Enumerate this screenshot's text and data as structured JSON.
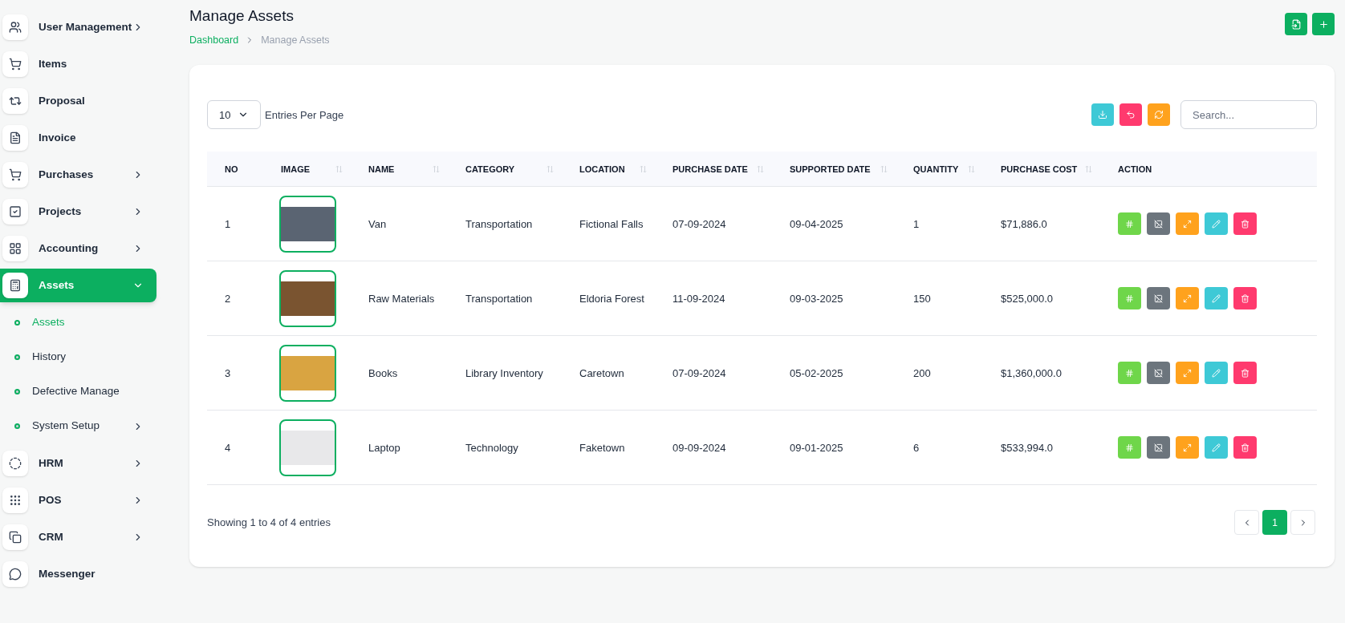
{
  "sidebar": {
    "items": [
      {
        "label": "User Management",
        "kind": "group",
        "selected": false
      },
      {
        "label": "Items",
        "kind": "link",
        "selected": false
      },
      {
        "label": "Proposal",
        "kind": "link",
        "selected": false
      },
      {
        "label": "Invoice",
        "kind": "link",
        "selected": false
      },
      {
        "label": "Purchases",
        "kind": "group",
        "selected": false
      },
      {
        "label": "Projects",
        "kind": "group",
        "selected": false
      },
      {
        "label": "Accounting",
        "kind": "group",
        "selected": false
      },
      {
        "label": "Assets",
        "kind": "group",
        "selected": true,
        "expanded": true,
        "children": [
          {
            "label": "Assets",
            "kind": "link",
            "selected": true
          },
          {
            "label": "History",
            "kind": "link",
            "selected": false
          },
          {
            "label": "Defective Manage",
            "kind": "link",
            "selected": false
          },
          {
            "label": "System Setup",
            "kind": "group",
            "selected": false
          }
        ]
      },
      {
        "label": "HRM",
        "kind": "group",
        "selected": false
      },
      {
        "label": "POS",
        "kind": "group",
        "selected": false
      },
      {
        "label": "CRM",
        "kind": "group",
        "selected": false
      },
      {
        "label": "Messenger",
        "kind": "link",
        "selected": false
      }
    ]
  },
  "page": {
    "title": "Manage Assets",
    "breadcrumb": [
      "Dashboard",
      "Manage Assets"
    ]
  },
  "toolbar": {
    "per_page": "10",
    "per_page_label": "Entries Per Page",
    "search": {
      "placeholder": "Search..."
    }
  },
  "table": {
    "columns": [
      {
        "label": "NO",
        "sortable": false
      },
      {
        "label": "IMAGE",
        "sortable": true
      },
      {
        "label": "NAME",
        "sortable": true
      },
      {
        "label": "CATEGORY",
        "sortable": true
      },
      {
        "label": "LOCATION",
        "sortable": true
      },
      {
        "label": "PURCHASE DATE",
        "sortable": true
      },
      {
        "label": "SUPPORTED DATE",
        "sortable": true
      },
      {
        "label": "QUANTITY",
        "sortable": true
      },
      {
        "label": "PURCHASE COST",
        "sortable": true
      },
      {
        "label": "ACTION",
        "sortable": false
      }
    ],
    "rows": [
      {
        "no": "1",
        "name": "Van",
        "category": "Transportation",
        "location": "Fictional Falls",
        "purchase_date": "07-09-2024",
        "supported_date": "09-04-2025",
        "quantity": "1",
        "purchase_cost": "$71,886.0"
      },
      {
        "no": "2",
        "name": "Raw Materials",
        "category": "Transportation",
        "location": "Eldoria Forest",
        "purchase_date": "11-09-2024",
        "supported_date": "09-03-2025",
        "quantity": "150",
        "purchase_cost": "$525,000.0"
      },
      {
        "no": "3",
        "name": "Books",
        "category": "Library Inventory",
        "location": "Caretown",
        "purchase_date": "07-09-2024",
        "supported_date": "05-02-2025",
        "quantity": "200",
        "purchase_cost": "$1,360,000.0"
      },
      {
        "no": "4",
        "name": "Laptop",
        "category": "Technology",
        "location": "Faketown",
        "purchase_date": "09-09-2024",
        "supported_date": "09-01-2025",
        "quantity": "6",
        "purchase_cost": "$533,994.0"
      }
    ]
  },
  "footer": {
    "summary": "Showing 1 to 4 of 4 entries",
    "pages": [
      {
        "label": "1",
        "selected": true
      }
    ]
  }
}
